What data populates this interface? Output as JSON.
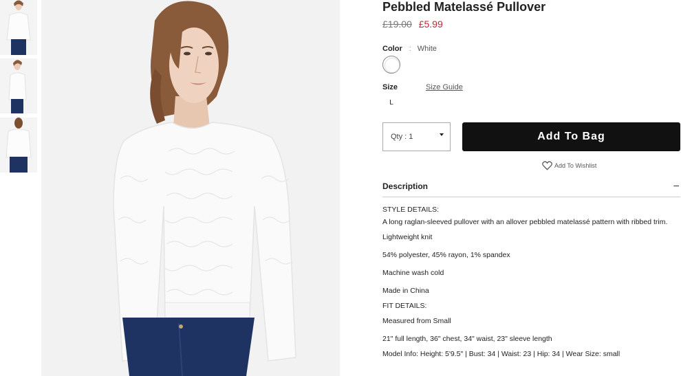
{
  "product": {
    "title": "Pebbled Matelassé Pullover",
    "old_price": "£19.00",
    "sale_price": "£5.99"
  },
  "color": {
    "label": "Color",
    "separator": ":",
    "value": "White",
    "swatch_hex": "#ffffff"
  },
  "size": {
    "label": "Size",
    "guide_link": "Size Guide",
    "options": [
      "L"
    ]
  },
  "quantity": {
    "label": "Qty : 1"
  },
  "actions": {
    "add_to_bag": "Add To Bag",
    "wishlist": "Add To Wishlist"
  },
  "description": {
    "title": "Description",
    "toggle": "–",
    "lines": [
      "STYLE DETAILS:",
      "A long raglan-sleeved pullover with an allover pebbled matelassé pattern with ribbed trim.",
      "Lightweight knit",
      "54% polyester, 45% rayon, 1% spandex",
      "Machine wash cold",
      "Made in China",
      "FIT DETAILS:",
      "Measured from Small",
      "21\" full length, 36\" chest, 34\" waist, 23\" sleeve length",
      "Model Info: Height: 5'9.5\" | Bust: 34 | Waist: 23 | Hip: 34 | Wear Size: small"
    ]
  },
  "colors": {
    "sale": "#c3272e",
    "button": "#111111",
    "garment": "#fafafa",
    "denim": "#1f3363",
    "hair": "#8a5b3a",
    "skin": "#edd0bd"
  }
}
